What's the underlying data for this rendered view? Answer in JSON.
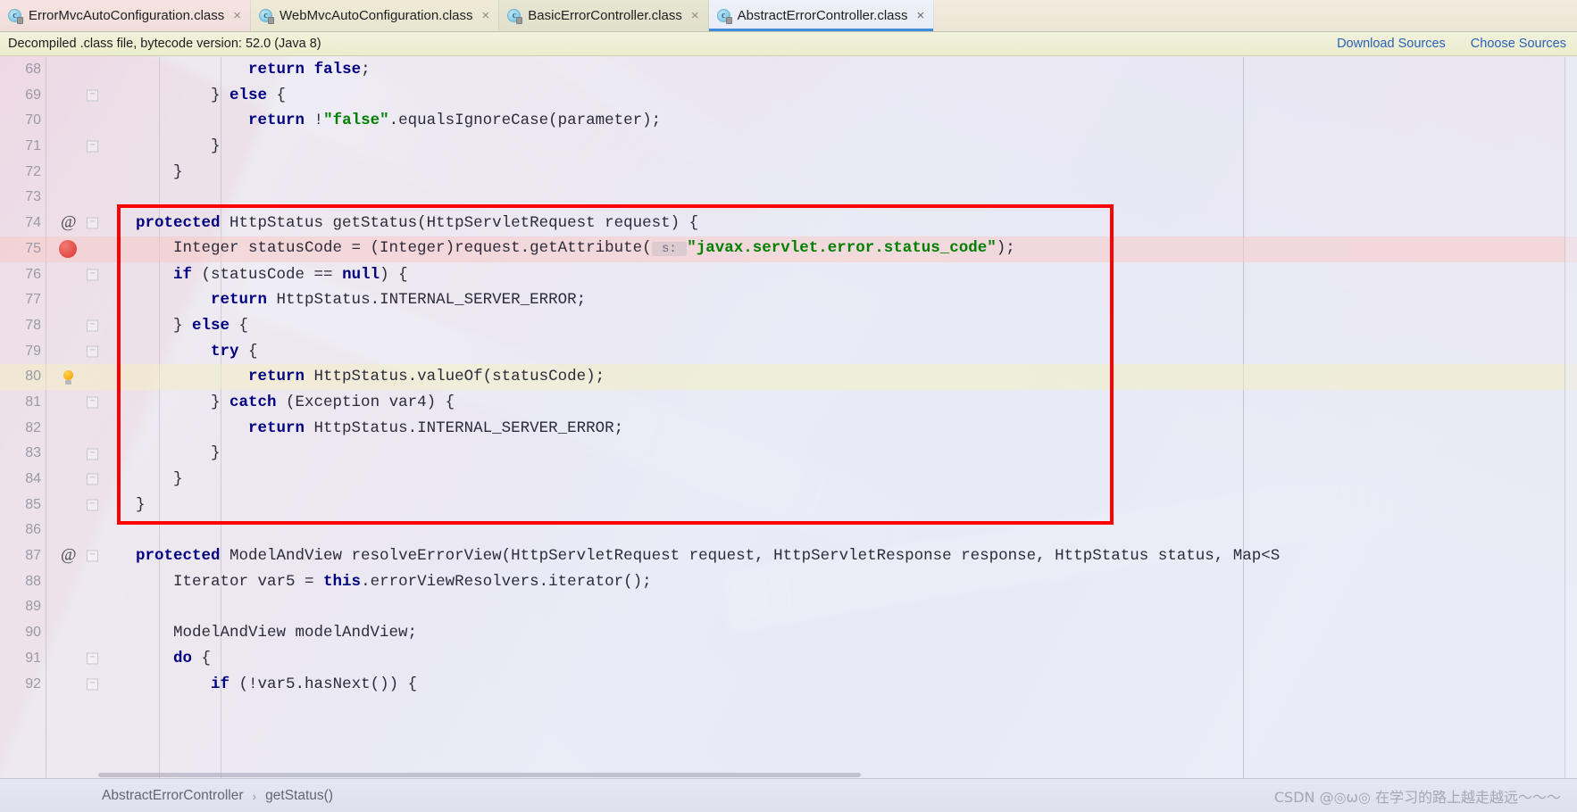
{
  "window": {
    "app": "IntelliJ IDEA editor"
  },
  "tabs": [
    {
      "label": "ErrorMvcAutoConfiguration.class",
      "icon": "java-class-icon",
      "icon_letter": "c",
      "close": "×",
      "active": false
    },
    {
      "label": "WebMvcAutoConfiguration.class",
      "icon": "java-class-icon",
      "icon_letter": "c",
      "close": "×",
      "active": false
    },
    {
      "label": "BasicErrorController.class",
      "icon": "java-class-icon",
      "icon_letter": "c",
      "close": "×",
      "active": false
    },
    {
      "label": "AbstractErrorController.class",
      "icon": "java-class-icon",
      "icon_letter": "c",
      "close": "×",
      "active": true
    }
  ],
  "notification": {
    "message": "Decompiled .class file, bytecode version: 52.0 (Java 8)",
    "download_sources": "Download Sources",
    "choose_sources": "Choose Sources"
  },
  "editor": {
    "first_line": 68,
    "lines": [
      {
        "n": 68,
        "gutter": "",
        "fold": "",
        "tokens": [
          {
            "t": "                ",
            "c": "pln"
          },
          {
            "t": "return",
            "c": "kw"
          },
          {
            "t": " ",
            "c": "pln"
          },
          {
            "t": "false",
            "c": "kw"
          },
          {
            "t": ";",
            "c": "pln"
          }
        ]
      },
      {
        "n": 69,
        "gutter": "",
        "fold": "end",
        "tokens": [
          {
            "t": "            } ",
            "c": "pln"
          },
          {
            "t": "else",
            "c": "kw"
          },
          {
            "t": " {",
            "c": "pln"
          }
        ]
      },
      {
        "n": 70,
        "gutter": "",
        "fold": "",
        "tokens": [
          {
            "t": "                ",
            "c": "pln"
          },
          {
            "t": "return",
            "c": "kw"
          },
          {
            "t": " !",
            "c": "pln"
          },
          {
            "t": "\"false\"",
            "c": "str"
          },
          {
            "t": ".equalsIgnoreCase(parameter);",
            "c": "pln"
          }
        ]
      },
      {
        "n": 71,
        "gutter": "",
        "fold": "end",
        "tokens": [
          {
            "t": "            }",
            "c": "pln"
          }
        ]
      },
      {
        "n": 72,
        "gutter": "",
        "fold": "",
        "tokens": [
          {
            "t": "        }",
            "c": "pln"
          }
        ]
      },
      {
        "n": 73,
        "gutter": "",
        "fold": "",
        "tokens": [
          {
            "t": "",
            "c": "pln"
          }
        ]
      },
      {
        "n": 74,
        "gutter": "at",
        "fold": "end",
        "tokens": [
          {
            "t": "    ",
            "c": "pln"
          },
          {
            "t": "protected",
            "c": "kw"
          },
          {
            "t": " HttpStatus getStatus(HttpServletRequest request) {",
            "c": "pln"
          }
        ]
      },
      {
        "n": 75,
        "gutter": "breakpoint",
        "fold": "",
        "highlight": "breakpoint",
        "tokens": [
          {
            "t": "        Integer statusCode = (Integer)request.getAttribute(",
            "c": "pln"
          },
          {
            "t": " s: ",
            "c": "hint"
          },
          {
            "t": "\"javax.servlet.error.status_code\"",
            "c": "str"
          },
          {
            "t": ");",
            "c": "pln"
          }
        ]
      },
      {
        "n": 76,
        "gutter": "",
        "fold": "end",
        "tokens": [
          {
            "t": "        ",
            "c": "pln"
          },
          {
            "t": "if",
            "c": "kw"
          },
          {
            "t": " (statusCode == ",
            "c": "pln"
          },
          {
            "t": "null",
            "c": "kw"
          },
          {
            "t": ") {",
            "c": "pln"
          }
        ]
      },
      {
        "n": 77,
        "gutter": "",
        "fold": "",
        "tokens": [
          {
            "t": "            ",
            "c": "pln"
          },
          {
            "t": "return",
            "c": "kw"
          },
          {
            "t": " HttpStatus.INTERNAL_SERVER_ERROR;",
            "c": "pln"
          }
        ]
      },
      {
        "n": 78,
        "gutter": "",
        "fold": "end",
        "tokens": [
          {
            "t": "        } ",
            "c": "pln"
          },
          {
            "t": "else",
            "c": "kw"
          },
          {
            "t": " {",
            "c": "pln"
          }
        ]
      },
      {
        "n": 79,
        "gutter": "",
        "fold": "end",
        "tokens": [
          {
            "t": "            ",
            "c": "pln"
          },
          {
            "t": "try",
            "c": "kw"
          },
          {
            "t": " {",
            "c": "pln"
          }
        ]
      },
      {
        "n": 80,
        "gutter": "bulb",
        "fold": "",
        "highlight": "caret",
        "tokens": [
          {
            "t": "                ",
            "c": "pln"
          },
          {
            "t": "return",
            "c": "kw"
          },
          {
            "t": " HttpStatus.valueOf(statusCode);",
            "c": "pln"
          }
        ]
      },
      {
        "n": 81,
        "gutter": "",
        "fold": "end",
        "tokens": [
          {
            "t": "            } ",
            "c": "pln"
          },
          {
            "t": "catch",
            "c": "kw"
          },
          {
            "t": " (Exception var4) {",
            "c": "pln"
          }
        ]
      },
      {
        "n": 82,
        "gutter": "",
        "fold": "",
        "tokens": [
          {
            "t": "                ",
            "c": "pln"
          },
          {
            "t": "return",
            "c": "kw"
          },
          {
            "t": " HttpStatus.INTERNAL_SERVER_ERROR;",
            "c": "pln"
          }
        ]
      },
      {
        "n": 83,
        "gutter": "",
        "fold": "end",
        "tokens": [
          {
            "t": "            }",
            "c": "pln"
          }
        ]
      },
      {
        "n": 84,
        "gutter": "",
        "fold": "end",
        "tokens": [
          {
            "t": "        }",
            "c": "pln"
          }
        ]
      },
      {
        "n": 85,
        "gutter": "",
        "fold": "end",
        "tokens": [
          {
            "t": "    }",
            "c": "pln"
          }
        ]
      },
      {
        "n": 86,
        "gutter": "",
        "fold": "",
        "tokens": [
          {
            "t": "",
            "c": "pln"
          }
        ]
      },
      {
        "n": 87,
        "gutter": "at",
        "fold": "end",
        "tokens": [
          {
            "t": "    ",
            "c": "pln"
          },
          {
            "t": "protected",
            "c": "kw"
          },
          {
            "t": " ModelAndView resolveErrorView(HttpServletRequest request, HttpServletResponse response, HttpStatus status, Map<S",
            "c": "pln"
          }
        ]
      },
      {
        "n": 88,
        "gutter": "",
        "fold": "",
        "tokens": [
          {
            "t": "        Iterator var5 = ",
            "c": "pln"
          },
          {
            "t": "this",
            "c": "kw"
          },
          {
            "t": ".errorViewResolvers.iterator();",
            "c": "pln"
          }
        ]
      },
      {
        "n": 89,
        "gutter": "",
        "fold": "",
        "tokens": [
          {
            "t": "",
            "c": "pln"
          }
        ]
      },
      {
        "n": 90,
        "gutter": "",
        "fold": "",
        "tokens": [
          {
            "t": "        ModelAndView modelAndView;",
            "c": "pln"
          }
        ]
      },
      {
        "n": 91,
        "gutter": "",
        "fold": "end",
        "tokens": [
          {
            "t": "        ",
            "c": "pln"
          },
          {
            "t": "do",
            "c": "kw"
          },
          {
            "t": " {",
            "c": "pln"
          }
        ]
      },
      {
        "n": 92,
        "gutter": "",
        "fold": "end",
        "tokens": [
          {
            "t": "            ",
            "c": "pln"
          },
          {
            "t": "if",
            "c": "kw"
          },
          {
            "t": " (!var5.hasNext()) {",
            "c": "pln"
          }
        ]
      }
    ],
    "annotation": {
      "type": "red-rectangle",
      "color": "#ff0000",
      "covers_lines": "74-85"
    }
  },
  "statusbar": {
    "breadcrumbs": [
      "AbstractErrorController",
      "getStatus()"
    ],
    "separator": "›",
    "watermark": "CSDN @◎ω◎ 在学习的路上越走越远～～～"
  },
  "colors": {
    "accent_tab_underline": "#3f8cd9",
    "link": "#2962b8",
    "keyword": "#000080",
    "string": "#008000",
    "annotation_box": "#ff0000",
    "breakpoint": "#e04a45"
  }
}
